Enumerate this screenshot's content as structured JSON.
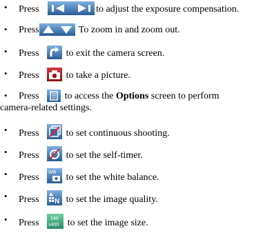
{
  "items": [
    {
      "press": "Press",
      "icons": [
        "left-arrow-icon",
        "right-arrow-icon"
      ],
      "text": "to adjust the exposure compensation."
    },
    {
      "press": "Press",
      "icons": [
        "zoom-in-icon",
        "zoom-out-icon"
      ],
      "text": " To zoom in and zoom out."
    },
    {
      "press": "Press",
      "icons": [
        "exit-arrow-icon"
      ],
      "text": " to exit the camera screen."
    },
    {
      "press": "Press",
      "icons": [
        "camera-icon"
      ],
      "text": " to take a picture."
    },
    {
      "press": "Press",
      "icons": [
        "options-icon"
      ],
      "text_before": " to access the ",
      "bold": "Options",
      "text_after": " screen to perform",
      "text_line2": "camera-related settings."
    },
    {
      "press": "Press",
      "icons": [
        "continuous-shooting-icon"
      ],
      "text": " to set continuous shooting."
    },
    {
      "press": "Press",
      "icons": [
        "self-timer-icon"
      ],
      "text": " to set the self-timer."
    },
    {
      "press": "Press",
      "icons": [
        "white-balance-icon"
      ],
      "text": " to set the white balance."
    },
    {
      "press": "Press",
      "icons": [
        "image-quality-icon"
      ],
      "text": " to set the image quality."
    },
    {
      "press": "Press",
      "icons": [
        "image-size-icon"
      ],
      "text": " to set the image size."
    }
  ],
  "icon_labels": {
    "white_balance": "WB",
    "quality": "N",
    "size_top": "240",
    "size_bottom": "x400"
  },
  "colors": {
    "icon_blue": "#4a87c9",
    "icon_dark": "#1b3d63"
  }
}
